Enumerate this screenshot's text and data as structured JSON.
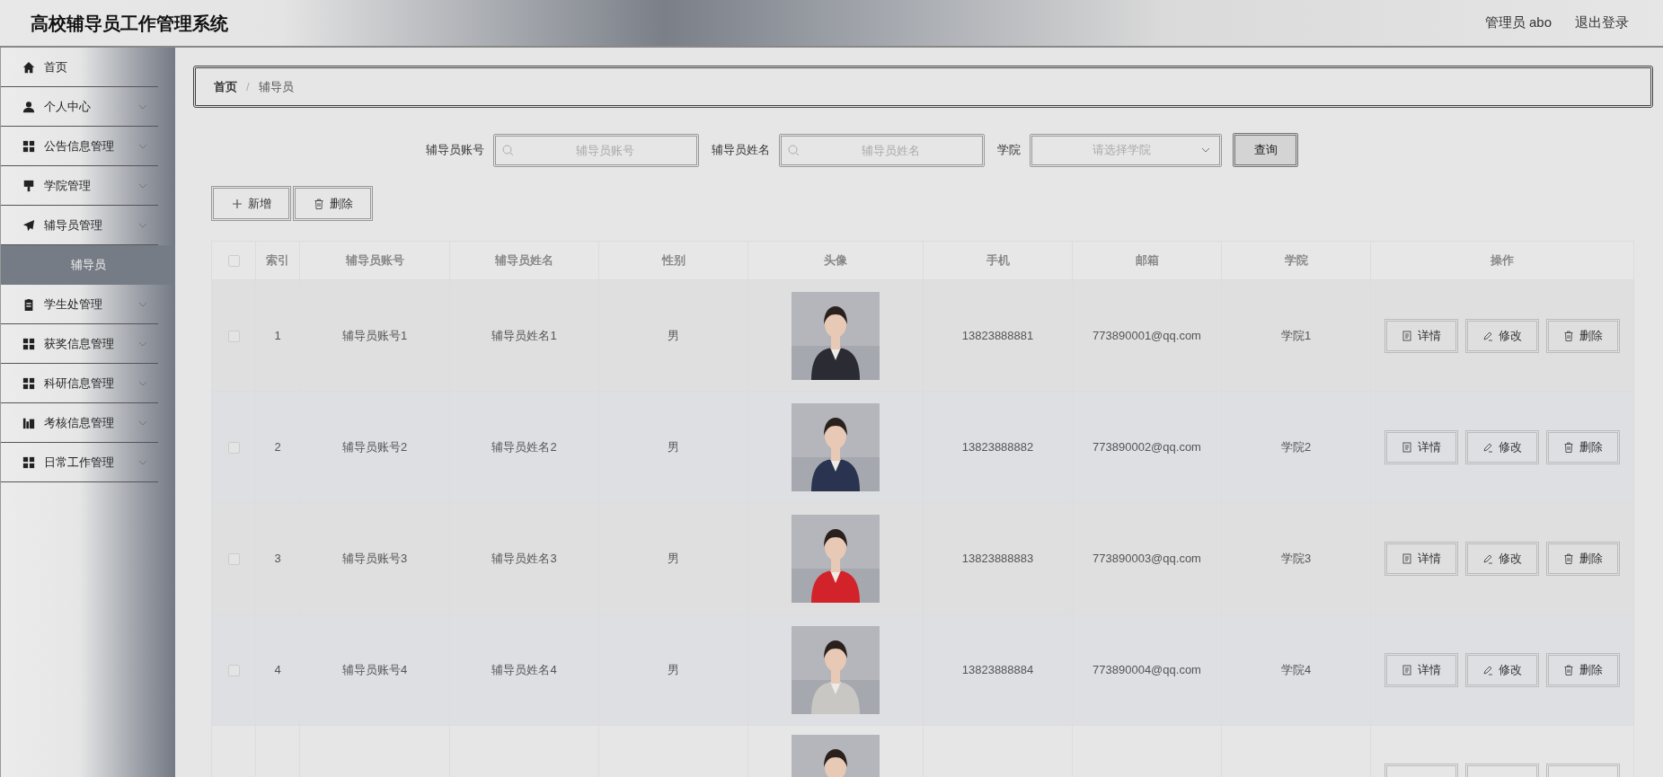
{
  "header": {
    "title": "高校辅导员工作管理系统",
    "user": "管理员 abo",
    "logout": "退出登录"
  },
  "sidebar": {
    "items": [
      {
        "label": "首页",
        "kind": "home",
        "expandable": false,
        "selected": false
      },
      {
        "label": "个人中心",
        "kind": "user",
        "expandable": true,
        "selected": false
      },
      {
        "label": "公告信息管理",
        "kind": "grid",
        "expandable": true,
        "selected": false
      },
      {
        "label": "学院管理",
        "kind": "sign",
        "expandable": true,
        "selected": false
      },
      {
        "label": "辅导员管理",
        "kind": "plane",
        "expandable": true,
        "selected": false,
        "children": [
          {
            "label": "辅导员",
            "selected": true
          }
        ]
      },
      {
        "label": "学生处管理",
        "kind": "clipboard",
        "expandable": true,
        "selected": false
      },
      {
        "label": "获奖信息管理",
        "kind": "grid",
        "expandable": true,
        "selected": false
      },
      {
        "label": "科研信息管理",
        "kind": "grid",
        "expandable": true,
        "selected": false
      },
      {
        "label": "考核信息管理",
        "kind": "chart",
        "expandable": true,
        "selected": false
      },
      {
        "label": "日常工作管理",
        "kind": "grid",
        "expandable": true,
        "selected": false
      }
    ]
  },
  "breadcrumb": [
    {
      "kind": "link",
      "text": "首页"
    },
    {
      "kind": "separator",
      "text": "/"
    },
    {
      "kind": "link",
      "text": "辅导员"
    }
  ],
  "search": {
    "fields": [
      {
        "label": "辅导员账号",
        "placeholder": "辅导员账号",
        "kind": "text"
      },
      {
        "label": "辅导员姓名",
        "placeholder": "辅导员姓名",
        "kind": "text"
      },
      {
        "label": "学院",
        "placeholder": "请选择学院",
        "kind": "select"
      }
    ],
    "button": "查询"
  },
  "toolbar": [
    {
      "label": "新增",
      "kind": "plus"
    },
    {
      "label": "删除",
      "kind": "trash"
    }
  ],
  "table": {
    "all_checked": false,
    "columns": [
      "索引",
      "辅导员账号",
      "辅导员姓名",
      "性别",
      "头像",
      "手机",
      "邮箱",
      "学院",
      "操作"
    ],
    "rows": [
      {
        "checked": false,
        "cells": [
          "1",
          "辅导员账号1",
          "辅导员姓名1",
          "男",
          "13823888881",
          "773890001@qq.com",
          "学院1"
        ],
        "actions": [
          {
            "label": "详情",
            "kind": "doc"
          },
          {
            "label": "修改",
            "kind": "pen"
          },
          {
            "label": "删除",
            "kind": "trash"
          }
        ]
      },
      {
        "checked": false,
        "cells": [
          "2",
          "辅导员账号2",
          "辅导员姓名2",
          "男",
          "13823888882",
          "773890002@qq.com",
          "学院2"
        ],
        "actions": [
          {
            "label": "详情",
            "kind": "doc"
          },
          {
            "label": "修改",
            "kind": "pen"
          },
          {
            "label": "删除",
            "kind": "trash"
          }
        ]
      },
      {
        "checked": false,
        "cells": [
          "3",
          "辅导员账号3",
          "辅导员姓名3",
          "男",
          "13823888883",
          "773890003@qq.com",
          "学院3"
        ],
        "actions": [
          {
            "label": "详情",
            "kind": "doc"
          },
          {
            "label": "修改",
            "kind": "pen"
          },
          {
            "label": "删除",
            "kind": "trash"
          }
        ]
      },
      {
        "checked": false,
        "cells": [
          "4",
          "辅导员账号4",
          "辅导员姓名4",
          "男",
          "13823888884",
          "773890004@qq.com",
          "学院4"
        ],
        "actions": [
          {
            "label": "详情",
            "kind": "doc"
          },
          {
            "label": "修改",
            "kind": "pen"
          },
          {
            "label": "删除",
            "kind": "trash"
          }
        ]
      },
      {
        "kind": "partial"
      }
    ]
  }
}
